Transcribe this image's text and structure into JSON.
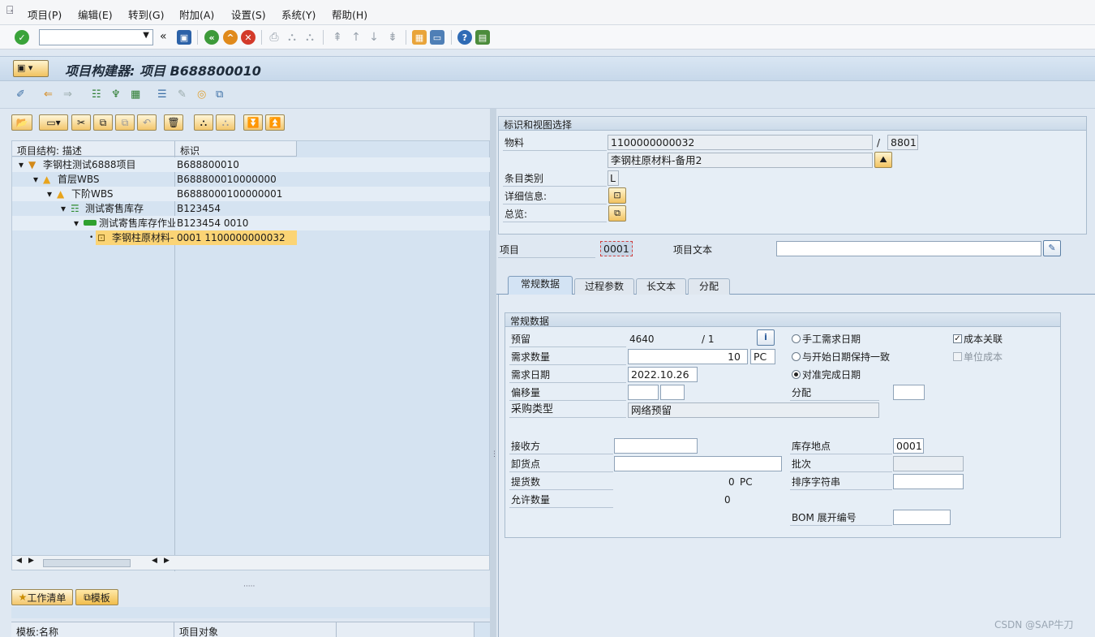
{
  "menu": [
    "项目(P)",
    "编辑(E)",
    "转到(G)",
    "附加(A)",
    "设置(S)",
    "系统(Y)",
    "帮助(H)"
  ],
  "title": "项目构建器: 项目 B688800010",
  "left": {
    "tree_headers": [
      "项目结构: 描述",
      "标识"
    ],
    "tree_rows": [
      {
        "desc": "李钢柱测试6888项目",
        "id": "B688800010",
        "icon": "project-icon"
      },
      {
        "desc": "首层WBS",
        "id": "B688800010000000",
        "icon": "wbs-icon"
      },
      {
        "desc": "下阶WBS",
        "id": "B6888000100000001",
        "icon": "wbs-icon"
      },
      {
        "desc": "测试寄售库存",
        "id": "B123454",
        "icon": "network-icon"
      },
      {
        "desc": "测试寄售库存作业",
        "id": "B123454 0010",
        "icon": "activity-icon"
      },
      {
        "desc": "李钢柱原材料-",
        "id": "0001 1100000000032",
        "icon": "material-icon"
      }
    ],
    "worklist": "工作清单",
    "templates": "模板",
    "bottom_headers": [
      "模板:名称",
      "项目对象"
    ]
  },
  "ident": {
    "header": "标识和视图选择",
    "material_label": "物料",
    "material": "1100000000032",
    "slash": "/",
    "plant": "8801",
    "material_desc": "李钢柱原材料-备用2",
    "category_label": "条目类别",
    "category": "L",
    "detail_label": "详细信息:",
    "overview_label": "总览:"
  },
  "item_label": "项目",
  "item": "0001",
  "itemtext_label": "项目文本",
  "itemtext": "",
  "tabs": [
    "常规数据",
    "过程参数",
    "长文本",
    "分配"
  ],
  "general": {
    "header": "常规数据",
    "reservation_label": "预留",
    "reservation": "4640",
    "res_item": "/  1",
    "req_qty_label": "需求数量",
    "req_qty": "10",
    "unit": "PC",
    "req_date_label": "需求日期",
    "req_date": "2022.10.26",
    "offset_label": "偏移量",
    "proc_label": "采购类型",
    "proc": "网络预留",
    "recipient_label": "接收方",
    "unload_label": "卸货点",
    "withdrawn_label": "提货数",
    "withdrawn": "0",
    "withdrawn_unit": "PC",
    "allowed_label": "允许数量",
    "allowed": "0",
    "radio1": "手工需求日期",
    "radio2": "与开始日期保持一致",
    "radio3": "对准完成日期",
    "assign_label": "分配",
    "cost_rel": "成本关联",
    "unit_cost": "单位成本",
    "sloc_label": "库存地点",
    "sloc": "0001",
    "batch_label": "批次",
    "sort_label": "排序字符串",
    "bom_label": "BOM 展开编号"
  },
  "watermark": "CSDN @SAP牛刀"
}
